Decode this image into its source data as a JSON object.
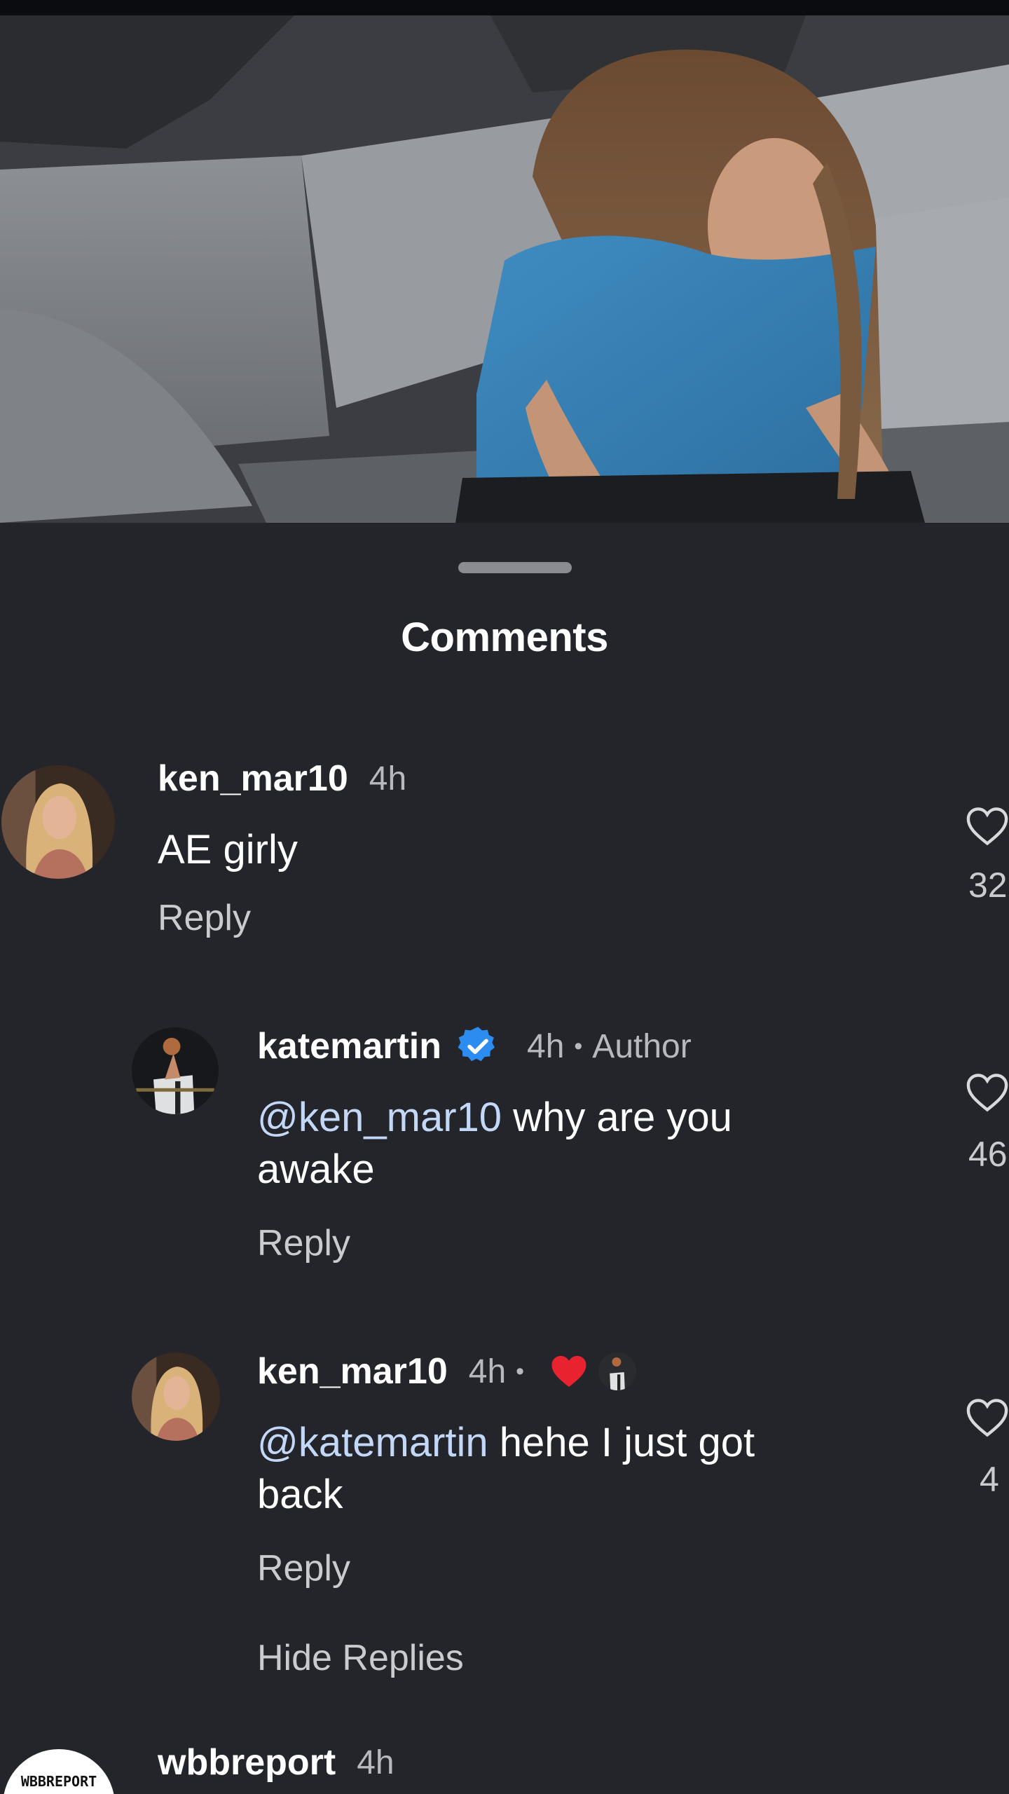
{
  "sheet": {
    "title": "Comments"
  },
  "comments": [
    {
      "username": "ken_mar10",
      "time": "4h",
      "text": "AE girly",
      "reply_label": "Reply",
      "likes": "32"
    },
    {
      "username": "katemartin",
      "verified": true,
      "time": "4h",
      "role": "Author",
      "mention": "@ken_mar10",
      "text": " why are you awake",
      "reply_label": "Reply",
      "likes": "46"
    },
    {
      "username": "ken_mar10",
      "time": "4h",
      "liked_by_author": true,
      "mention": "@katemartin",
      "text": " hehe I just got back",
      "reply_label": "Reply",
      "likes": "4"
    },
    {
      "username": "wbbreport",
      "time": "4h",
      "avatar_text": "WBBREPORT"
    }
  ],
  "thread": {
    "hide_replies_label": "Hide Replies"
  },
  "colors": {
    "background": "#23252b",
    "mention": "#c3d8f7",
    "verified": "#2d8cf0",
    "heart": "#e8232f"
  },
  "icons": [
    "heart-outline-icon",
    "verified-badge-icon",
    "red-heart-icon"
  ]
}
